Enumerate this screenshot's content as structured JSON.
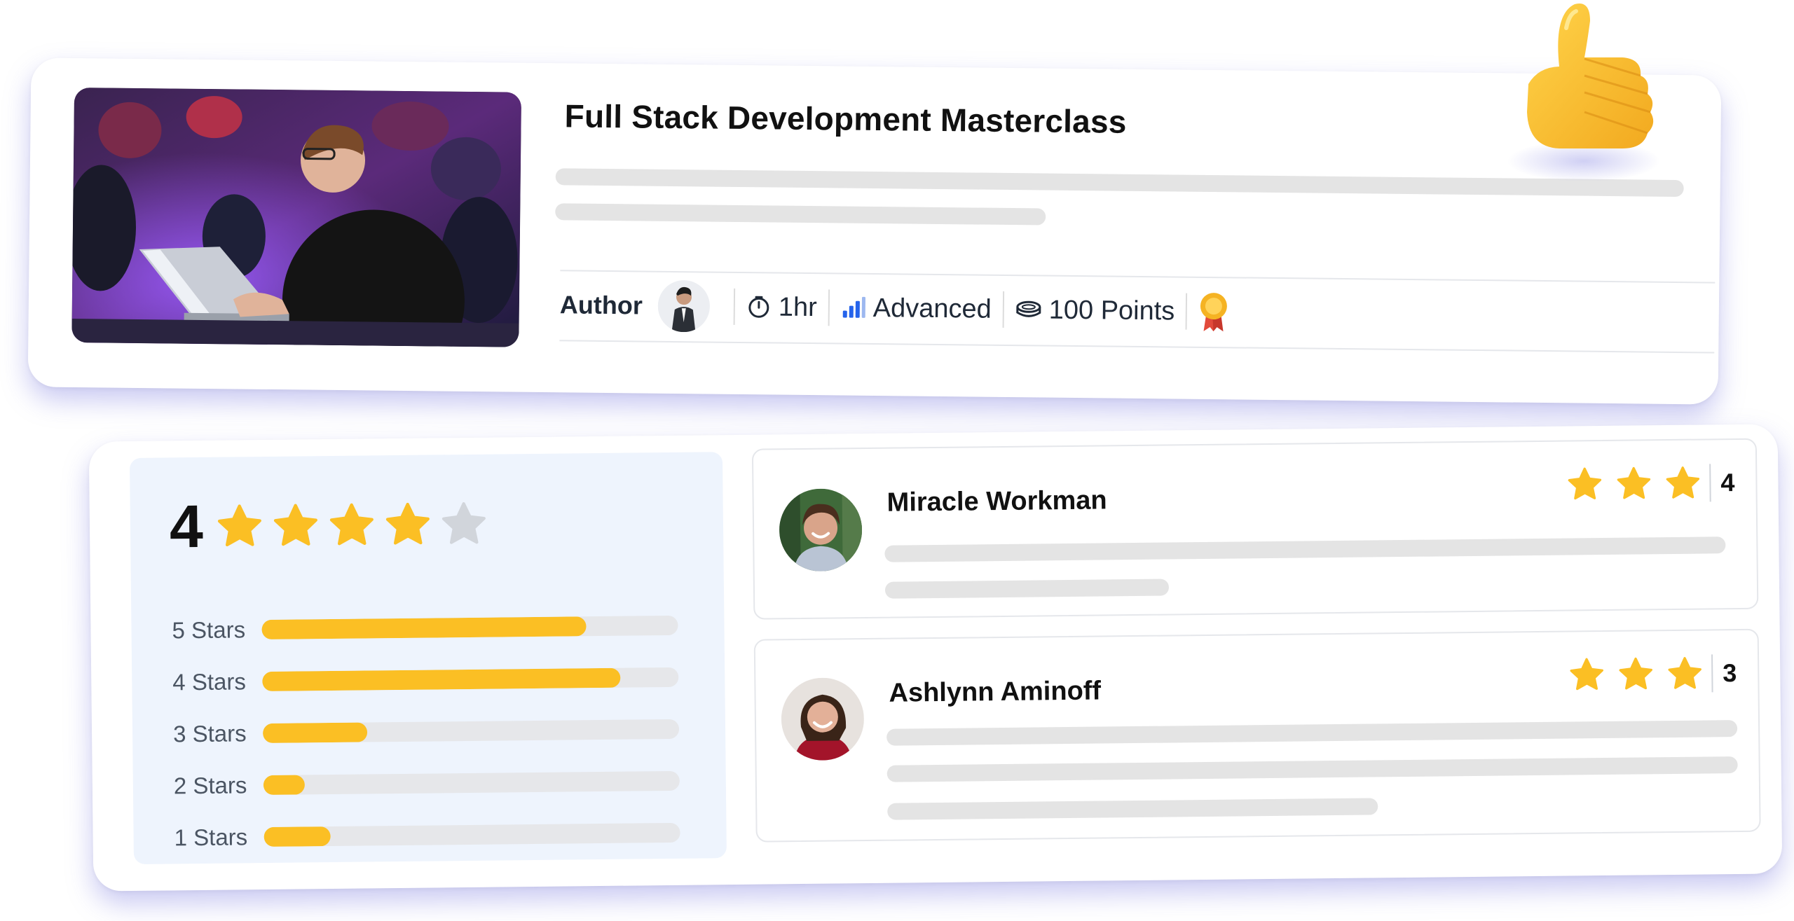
{
  "course": {
    "title": "Full Stack Development Masterclass",
    "author_label": "Author",
    "duration": "1hr",
    "level": "Advanced",
    "points": "100 Points",
    "icons": [
      "timer-icon",
      "level-bars-icon",
      "coin-icon",
      "award-ribbon-icon",
      "thumbs-up-emoji"
    ]
  },
  "ratings": {
    "average": "4",
    "average_stars": 4,
    "max_stars": 5,
    "star_color": "#FBBF24",
    "empty_star_color": "#D1D5DB",
    "breakdown": [
      {
        "label": "5 Stars",
        "fill": 0.78
      },
      {
        "label": "4 Stars",
        "fill": 0.86
      },
      {
        "label": "3 Stars",
        "fill": 0.25
      },
      {
        "label": "2 Stars",
        "fill": 0.1
      },
      {
        "label": "1 Stars",
        "fill": 0.16
      }
    ]
  },
  "reviews": [
    {
      "name": "Miracle Workman",
      "stars": 3,
      "rating": "4"
    },
    {
      "name": "Ashlynn Aminoff",
      "stars": 3,
      "rating": "3"
    }
  ]
}
